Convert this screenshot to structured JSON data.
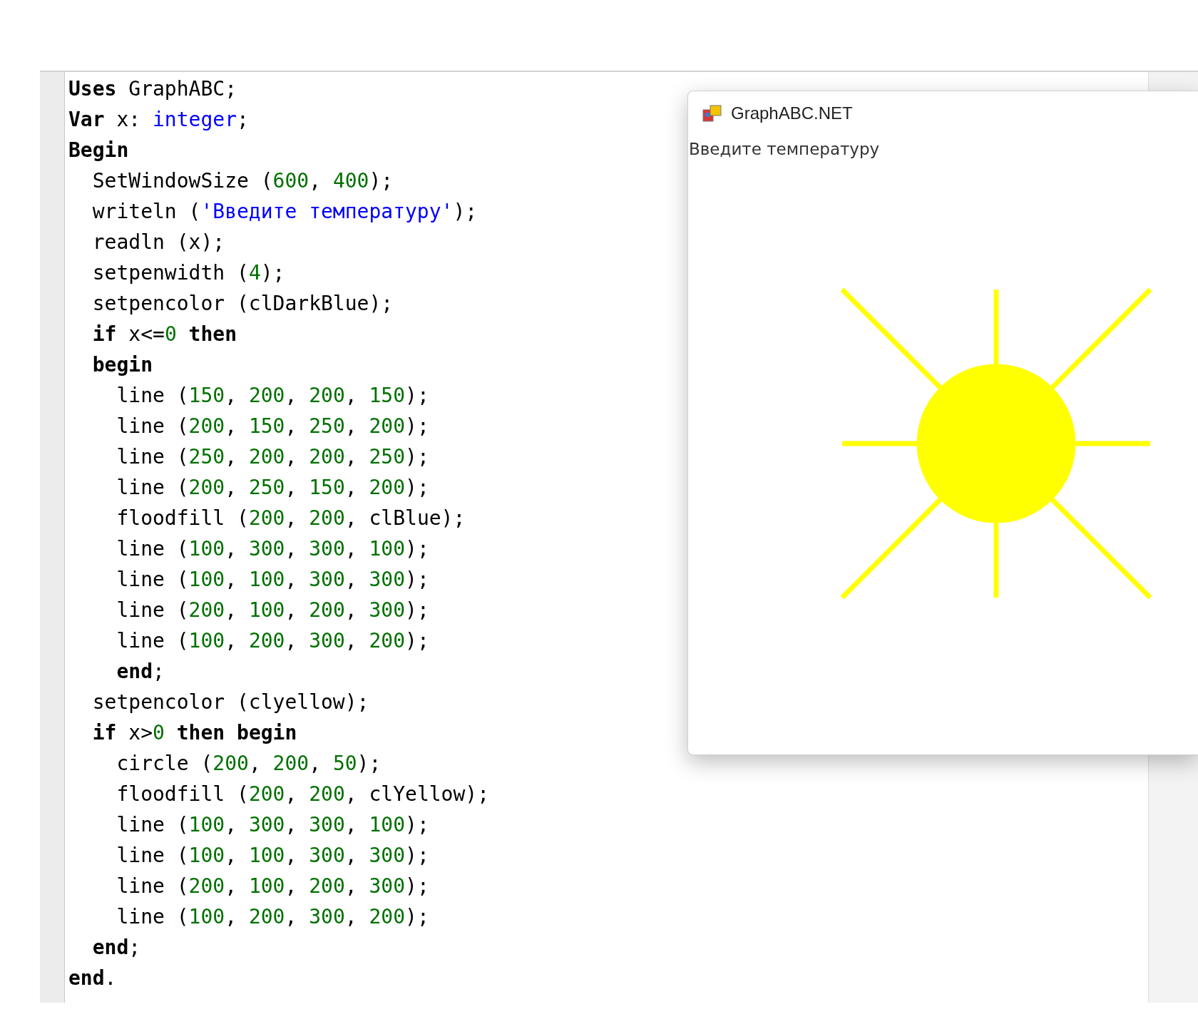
{
  "editor": {
    "lines": [
      [
        {
          "kind": "kw",
          "text": "Uses"
        },
        {
          "kind": "plain",
          "text": " GraphABC;"
        }
      ],
      [
        {
          "kind": "kw",
          "text": "Var"
        },
        {
          "kind": "plain",
          "text": " x: "
        },
        {
          "kind": "type",
          "text": "integer"
        },
        {
          "kind": "plain",
          "text": ";"
        }
      ],
      [
        {
          "kind": "kw",
          "text": "Begin"
        }
      ],
      [
        {
          "kind": "plain",
          "text": "  SetWindowSize ("
        },
        {
          "kind": "num",
          "text": "600"
        },
        {
          "kind": "plain",
          "text": ", "
        },
        {
          "kind": "num",
          "text": "400"
        },
        {
          "kind": "plain",
          "text": ");"
        }
      ],
      [
        {
          "kind": "plain",
          "text": "  writeln ("
        },
        {
          "kind": "str",
          "text": "'Введите температуру'"
        },
        {
          "kind": "plain",
          "text": ");"
        }
      ],
      [
        {
          "kind": "plain",
          "text": "  readln (x);"
        }
      ],
      [
        {
          "kind": "plain",
          "text": "  setpenwidth ("
        },
        {
          "kind": "num",
          "text": "4"
        },
        {
          "kind": "plain",
          "text": ");"
        }
      ],
      [
        {
          "kind": "plain",
          "text": "  setpencolor (clDarkBlue);"
        }
      ],
      [
        {
          "kind": "kw",
          "text": "  if"
        },
        {
          "kind": "plain",
          "text": " x<="
        },
        {
          "kind": "num",
          "text": "0"
        },
        {
          "kind": "kw",
          "text": " then"
        }
      ],
      [
        {
          "kind": "kw",
          "text": "  begin"
        }
      ],
      [
        {
          "kind": "plain",
          "text": "    line ("
        },
        {
          "kind": "num",
          "text": "150"
        },
        {
          "kind": "plain",
          "text": ", "
        },
        {
          "kind": "num",
          "text": "200"
        },
        {
          "kind": "plain",
          "text": ", "
        },
        {
          "kind": "num",
          "text": "200"
        },
        {
          "kind": "plain",
          "text": ", "
        },
        {
          "kind": "num",
          "text": "150"
        },
        {
          "kind": "plain",
          "text": ");"
        }
      ],
      [
        {
          "kind": "plain",
          "text": "    line ("
        },
        {
          "kind": "num",
          "text": "200"
        },
        {
          "kind": "plain",
          "text": ", "
        },
        {
          "kind": "num",
          "text": "150"
        },
        {
          "kind": "plain",
          "text": ", "
        },
        {
          "kind": "num",
          "text": "250"
        },
        {
          "kind": "plain",
          "text": ", "
        },
        {
          "kind": "num",
          "text": "200"
        },
        {
          "kind": "plain",
          "text": ");"
        }
      ],
      [
        {
          "kind": "plain",
          "text": "    line ("
        },
        {
          "kind": "num",
          "text": "250"
        },
        {
          "kind": "plain",
          "text": ", "
        },
        {
          "kind": "num",
          "text": "200"
        },
        {
          "kind": "plain",
          "text": ", "
        },
        {
          "kind": "num",
          "text": "200"
        },
        {
          "kind": "plain",
          "text": ", "
        },
        {
          "kind": "num",
          "text": "250"
        },
        {
          "kind": "plain",
          "text": ");"
        }
      ],
      [
        {
          "kind": "plain",
          "text": "    line ("
        },
        {
          "kind": "num",
          "text": "200"
        },
        {
          "kind": "plain",
          "text": ", "
        },
        {
          "kind": "num",
          "text": "250"
        },
        {
          "kind": "plain",
          "text": ", "
        },
        {
          "kind": "num",
          "text": "150"
        },
        {
          "kind": "plain",
          "text": ", "
        },
        {
          "kind": "num",
          "text": "200"
        },
        {
          "kind": "plain",
          "text": ");"
        }
      ],
      [
        {
          "kind": "plain",
          "text": "    floodfill ("
        },
        {
          "kind": "num",
          "text": "200"
        },
        {
          "kind": "plain",
          "text": ", "
        },
        {
          "kind": "num",
          "text": "200"
        },
        {
          "kind": "plain",
          "text": ", clBlue);"
        }
      ],
      [
        {
          "kind": "plain",
          "text": "    line ("
        },
        {
          "kind": "num",
          "text": "100"
        },
        {
          "kind": "plain",
          "text": ", "
        },
        {
          "kind": "num",
          "text": "300"
        },
        {
          "kind": "plain",
          "text": ", "
        },
        {
          "kind": "num",
          "text": "300"
        },
        {
          "kind": "plain",
          "text": ", "
        },
        {
          "kind": "num",
          "text": "100"
        },
        {
          "kind": "plain",
          "text": ");"
        }
      ],
      [
        {
          "kind": "plain",
          "text": "    line ("
        },
        {
          "kind": "num",
          "text": "100"
        },
        {
          "kind": "plain",
          "text": ", "
        },
        {
          "kind": "num",
          "text": "100"
        },
        {
          "kind": "plain",
          "text": ", "
        },
        {
          "kind": "num",
          "text": "300"
        },
        {
          "kind": "plain",
          "text": ", "
        },
        {
          "kind": "num",
          "text": "300"
        },
        {
          "kind": "plain",
          "text": ");"
        }
      ],
      [
        {
          "kind": "plain",
          "text": "    line ("
        },
        {
          "kind": "num",
          "text": "200"
        },
        {
          "kind": "plain",
          "text": ", "
        },
        {
          "kind": "num",
          "text": "100"
        },
        {
          "kind": "plain",
          "text": ", "
        },
        {
          "kind": "num",
          "text": "200"
        },
        {
          "kind": "plain",
          "text": ", "
        },
        {
          "kind": "num",
          "text": "300"
        },
        {
          "kind": "plain",
          "text": ");"
        }
      ],
      [
        {
          "kind": "plain",
          "text": "    line ("
        },
        {
          "kind": "num",
          "text": "100"
        },
        {
          "kind": "plain",
          "text": ", "
        },
        {
          "kind": "num",
          "text": "200"
        },
        {
          "kind": "plain",
          "text": ", "
        },
        {
          "kind": "num",
          "text": "300"
        },
        {
          "kind": "plain",
          "text": ", "
        },
        {
          "kind": "num",
          "text": "200"
        },
        {
          "kind": "plain",
          "text": ");"
        }
      ],
      [
        {
          "kind": "kw",
          "text": "    end"
        },
        {
          "kind": "plain",
          "text": ";"
        }
      ],
      [
        {
          "kind": "plain",
          "text": "  setpencolor (clyellow);"
        }
      ],
      [
        {
          "kind": "kw",
          "text": "  if"
        },
        {
          "kind": "plain",
          "text": " x>"
        },
        {
          "kind": "num",
          "text": "0"
        },
        {
          "kind": "kw",
          "text": " then begin"
        }
      ],
      [
        {
          "kind": "plain",
          "text": "    circle ("
        },
        {
          "kind": "num",
          "text": "200"
        },
        {
          "kind": "plain",
          "text": ", "
        },
        {
          "kind": "num",
          "text": "200"
        },
        {
          "kind": "plain",
          "text": ", "
        },
        {
          "kind": "num",
          "text": "50"
        },
        {
          "kind": "plain",
          "text": ");"
        }
      ],
      [
        {
          "kind": "plain",
          "text": "    floodfill ("
        },
        {
          "kind": "num",
          "text": "200"
        },
        {
          "kind": "plain",
          "text": ", "
        },
        {
          "kind": "num",
          "text": "200"
        },
        {
          "kind": "plain",
          "text": ", clYellow);"
        }
      ],
      [
        {
          "kind": "plain",
          "text": "    line ("
        },
        {
          "kind": "num",
          "text": "100"
        },
        {
          "kind": "plain",
          "text": ", "
        },
        {
          "kind": "num",
          "text": "300"
        },
        {
          "kind": "plain",
          "text": ", "
        },
        {
          "kind": "num",
          "text": "300"
        },
        {
          "kind": "plain",
          "text": ", "
        },
        {
          "kind": "num",
          "text": "100"
        },
        {
          "kind": "plain",
          "text": ");"
        }
      ],
      [
        {
          "kind": "plain",
          "text": "    line ("
        },
        {
          "kind": "num",
          "text": "100"
        },
        {
          "kind": "plain",
          "text": ", "
        },
        {
          "kind": "num",
          "text": "100"
        },
        {
          "kind": "plain",
          "text": ", "
        },
        {
          "kind": "num",
          "text": "300"
        },
        {
          "kind": "plain",
          "text": ", "
        },
        {
          "kind": "num",
          "text": "300"
        },
        {
          "kind": "plain",
          "text": ");"
        }
      ],
      [
        {
          "kind": "plain",
          "text": "    line ("
        },
        {
          "kind": "num",
          "text": "200"
        },
        {
          "kind": "plain",
          "text": ", "
        },
        {
          "kind": "num",
          "text": "100"
        },
        {
          "kind": "plain",
          "text": ", "
        },
        {
          "kind": "num",
          "text": "200"
        },
        {
          "kind": "plain",
          "text": ", "
        },
        {
          "kind": "num",
          "text": "300"
        },
        {
          "kind": "plain",
          "text": ");"
        }
      ],
      [
        {
          "kind": "plain",
          "text": "    line ("
        },
        {
          "kind": "num",
          "text": "100"
        },
        {
          "kind": "plain",
          "text": ", "
        },
        {
          "kind": "num",
          "text": "200"
        },
        {
          "kind": "plain",
          "text": ", "
        },
        {
          "kind": "num",
          "text": "300"
        },
        {
          "kind": "plain",
          "text": ", "
        },
        {
          "kind": "num",
          "text": "200"
        },
        {
          "kind": "plain",
          "text": ");"
        }
      ],
      [
        {
          "kind": "kw",
          "text": "  end"
        },
        {
          "kind": "plain",
          "text": ";"
        }
      ],
      [
        {
          "kind": "kw",
          "text": "end"
        },
        {
          "kind": "plain",
          "text": "."
        }
      ]
    ]
  },
  "output_window": {
    "title": "GraphABC.NET",
    "prompt": "Введите температуру"
  }
}
